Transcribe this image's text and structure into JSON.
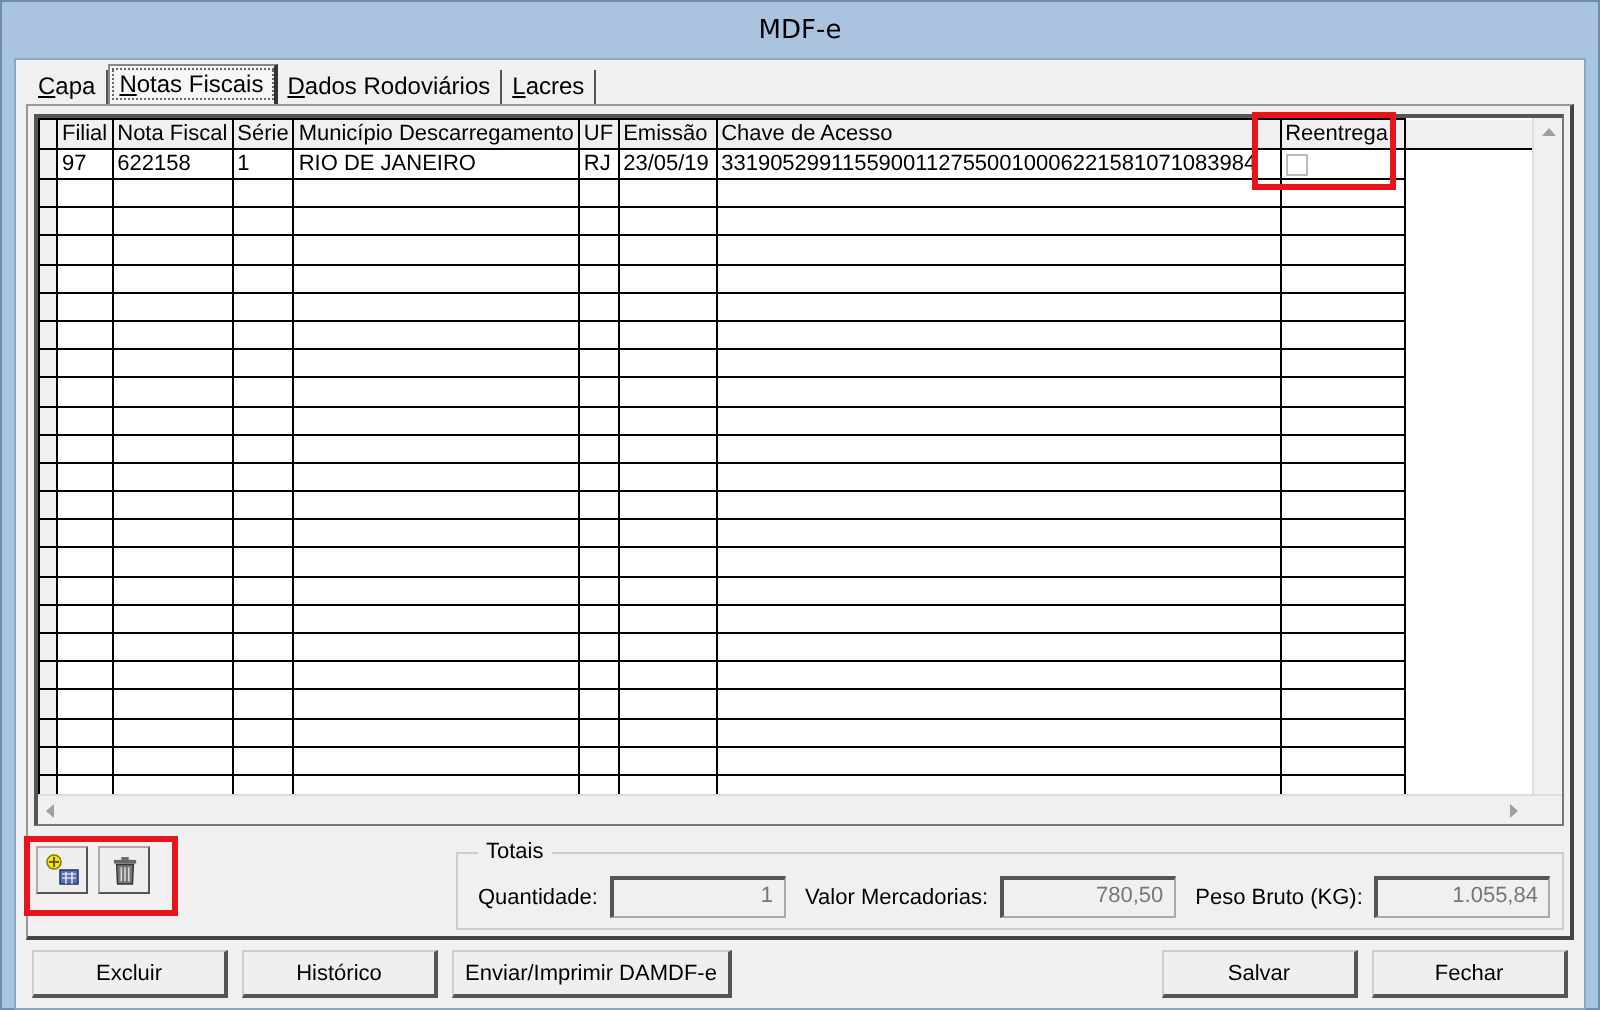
{
  "window": {
    "title": "MDF-e"
  },
  "tabs": [
    {
      "label": "Capa",
      "selected": false
    },
    {
      "label": "Notas Fiscais",
      "selected": true
    },
    {
      "label": "Dados Rodoviários",
      "selected": false
    },
    {
      "label": "Lacres",
      "selected": false
    }
  ],
  "table": {
    "columns": [
      "Filial",
      "Nota Fiscal",
      "Série",
      "Município Descarregamento",
      "UF",
      "Emissão",
      "Chave de Acesso",
      "Reentrega"
    ],
    "rows": [
      {
        "cells": [
          "97",
          "622158",
          "1",
          "RIO DE JANEIRO",
          "RJ",
          "23/05/19",
          "33190529911559001127550010006221581071083984"
        ],
        "reentrega": false
      }
    ]
  },
  "totals": {
    "title": "Totais",
    "fields": [
      {
        "label": "Quantidade:",
        "value": "1"
      },
      {
        "label": "Valor Mercadorias:",
        "value": "780,50"
      },
      {
        "label": "Peso Bruto (KG):",
        "value": "1.055,84"
      }
    ]
  },
  "buttons_left": [
    "Excluir",
    "Histórico",
    "Enviar/Imprimir DAMDF-e"
  ],
  "buttons_right": [
    "Salvar",
    "Fechar"
  ]
}
